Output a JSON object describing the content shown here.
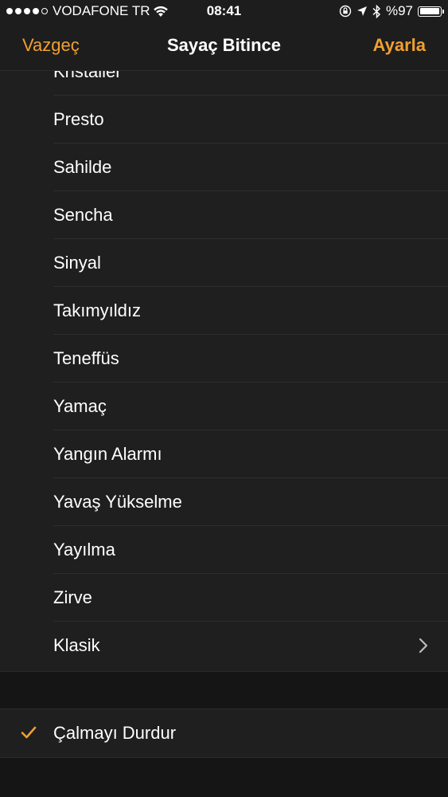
{
  "status_bar": {
    "carrier": "VODAFONE TR",
    "time": "08:41",
    "battery": "%97",
    "battery_level": 0.97,
    "signal_bars_filled": 4,
    "signal_bars_total": 5
  },
  "nav": {
    "cancel_label": "Vazgeç",
    "title": "Sayaç Bitince",
    "set_label": "Ayarla"
  },
  "sounds": [
    "Kristaller",
    "Presto",
    "Sahilde",
    "Sencha",
    "Sinyal",
    "Takımyıldız",
    "Teneffüs",
    "Yamaç",
    "Yangın Alarmı",
    "Yavaş Yükselme",
    "Yayılma",
    "Zirve"
  ],
  "classic": {
    "label": "Klasik"
  },
  "stop_playing": {
    "label": "Çalmayı Durdur",
    "selected": true
  },
  "colors": {
    "accent": "#f0a030",
    "background": "#151515",
    "cell": "#1f1f1f"
  }
}
